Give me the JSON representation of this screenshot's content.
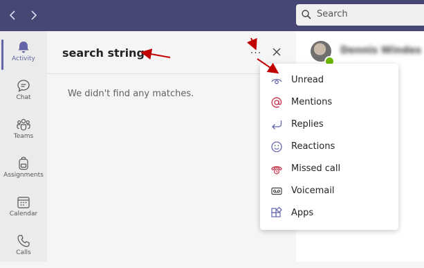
{
  "topbar": {
    "back_icon": "chevron-left-icon",
    "forward_icon": "chevron-right-icon",
    "search_placeholder": "Search"
  },
  "rail": {
    "items": [
      {
        "label": "Activity",
        "icon": "bell-icon",
        "active": true
      },
      {
        "label": "Chat",
        "icon": "chat-icon"
      },
      {
        "label": "Teams",
        "icon": "teams-icon"
      },
      {
        "label": "Assignments",
        "icon": "backpack-icon"
      },
      {
        "label": "Calendar",
        "icon": "calendar-icon"
      },
      {
        "label": "Calls",
        "icon": "phone-icon"
      }
    ]
  },
  "panel": {
    "title": "search string",
    "empty_message": "We didn't find any matches."
  },
  "header_right": {
    "user_name": "Dennis Windes"
  },
  "filter_menu": {
    "items": [
      {
        "label": "Unread",
        "icon": "eye-icon",
        "color": "#6264a7"
      },
      {
        "label": "Mentions",
        "icon": "at-icon",
        "color": "#c4314b"
      },
      {
        "label": "Replies",
        "icon": "reply-icon",
        "color": "#6264a7"
      },
      {
        "label": "Reactions",
        "icon": "smiley-icon",
        "color": "#6264a7"
      },
      {
        "label": "Missed call",
        "icon": "missed-call-icon",
        "color": "#c4314b"
      },
      {
        "label": "Voicemail",
        "icon": "voicemail-icon",
        "color": "#424242"
      },
      {
        "label": "Apps",
        "icon": "apps-icon",
        "color": "#6264a7"
      }
    ]
  },
  "colors": {
    "brand": "#464775",
    "accent": "#6264a7",
    "annotation_arrow": "#c00000",
    "presence_available": "#6bb700"
  }
}
